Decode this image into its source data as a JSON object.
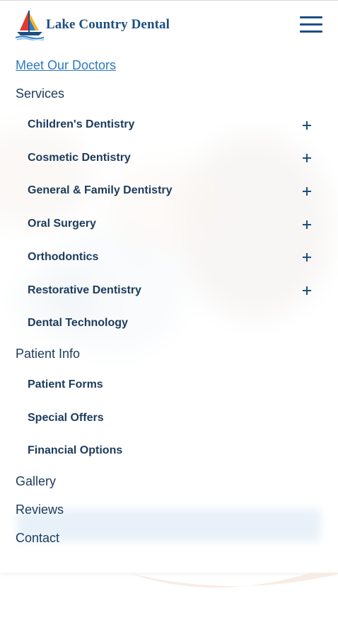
{
  "brand": {
    "name": "Lake Country Dental"
  },
  "header": {
    "menu_icon": "hamburger-menu-icon"
  },
  "menu": {
    "meet_doctors": "Meet Our Doctors",
    "services": {
      "label": "Services",
      "items": [
        {
          "label": "Children's Dentistry",
          "expandable": true
        },
        {
          "label": "Cosmetic Dentistry",
          "expandable": true
        },
        {
          "label": "General & Family Dentistry",
          "expandable": true
        },
        {
          "label": "Oral Surgery",
          "expandable": true
        },
        {
          "label": "Orthodontics",
          "expandable": true
        },
        {
          "label": "Restorative Dentistry",
          "expandable": true
        },
        {
          "label": "Dental Technology",
          "expandable": false
        }
      ]
    },
    "patient_info": {
      "label": "Patient Info",
      "items": [
        {
          "label": "Patient Forms"
        },
        {
          "label": "Special Offers"
        },
        {
          "label": "Financial Options"
        }
      ]
    },
    "gallery": "Gallery",
    "reviews": "Reviews",
    "contact": "Contact"
  },
  "colors": {
    "brand_blue": "#1e4f82",
    "link_blue": "#2d7ac0",
    "text_navy": "#1d3b5c"
  }
}
